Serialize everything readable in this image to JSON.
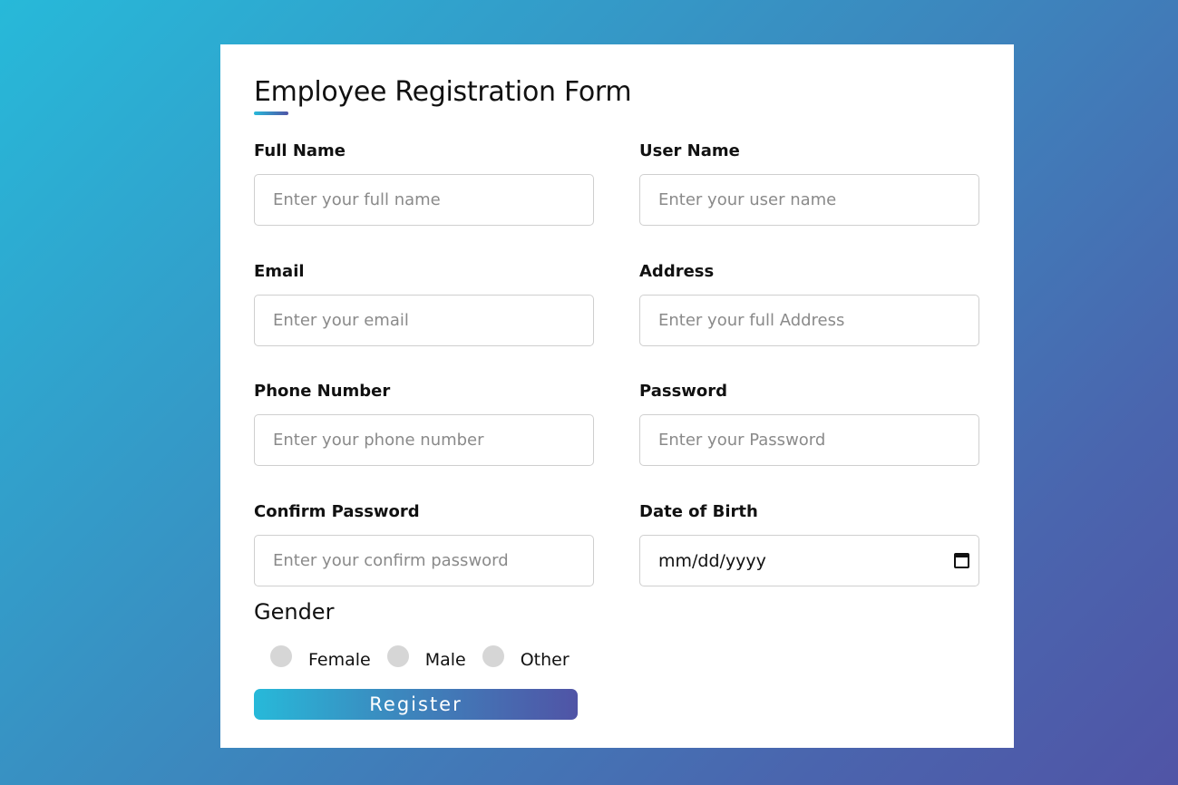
{
  "form": {
    "title": "Employee Registration Form",
    "fields": {
      "full_name": {
        "label": "Full Name",
        "placeholder": "Enter your full name"
      },
      "user_name": {
        "label": "User Name",
        "placeholder": "Enter your user name"
      },
      "email": {
        "label": "Email",
        "placeholder": "Enter your email"
      },
      "address": {
        "label": "Address",
        "placeholder": "Enter your full Address"
      },
      "phone": {
        "label": "Phone Number",
        "placeholder": "Enter your phone number"
      },
      "password": {
        "label": "Password",
        "placeholder": "Enter your Password"
      },
      "confirm_password": {
        "label": "Confirm Password",
        "placeholder": "Enter your confirm password"
      },
      "dob": {
        "label": "Date of Birth",
        "value": "mm/dd/yyyy",
        "icon": "calendar-icon"
      }
    },
    "gender": {
      "title": "Gender",
      "options": [
        "Female",
        "Male",
        "Other"
      ]
    },
    "register_label": "Register"
  },
  "colors": {
    "gradient_start": "#27b9d9",
    "gradient_end": "#5054a6",
    "card_bg": "#ffffff",
    "radio_bg": "#d6d6d6"
  }
}
